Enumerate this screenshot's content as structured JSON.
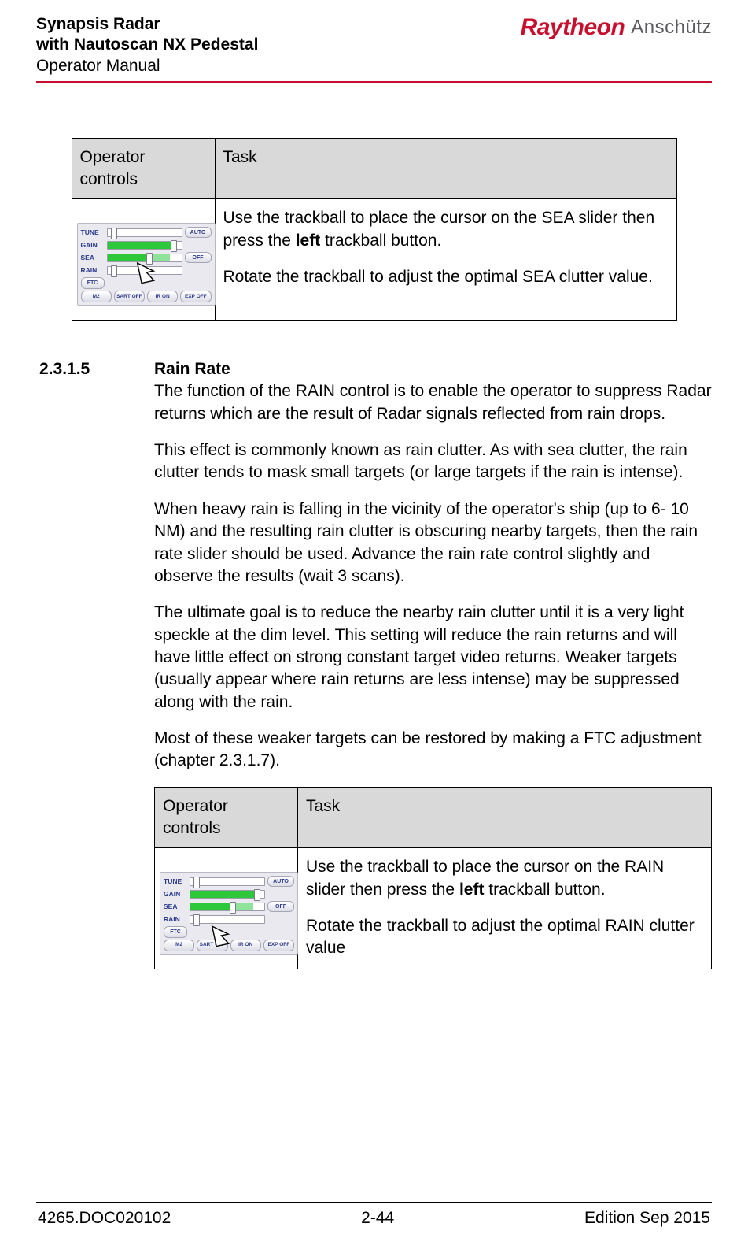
{
  "header": {
    "line1": "Synapsis Radar",
    "line2": "with Nautoscan NX Pedestal",
    "line3": "Operator Manual",
    "brand_primary": "Raytheon",
    "brand_secondary": "Anschütz"
  },
  "panel": {
    "rows": {
      "tune": {
        "label": "TUNE",
        "button": "AUTO"
      },
      "gain": {
        "label": "GAIN"
      },
      "sea": {
        "label": "SEA",
        "button": "OFF"
      },
      "rain": {
        "label": "RAIN"
      },
      "ftc": {
        "label": "FTC"
      }
    },
    "bottom_buttons": {
      "b1": "M2",
      "b2": "SART OFF",
      "b3": "IR ON",
      "b4": "EXP OFF"
    }
  },
  "tables": {
    "header_col1": "Operator controls",
    "header_col2": "Task",
    "sea": {
      "task_line1_pre": "Use the trackball to place the cursor on the SEA slider then press the ",
      "task_line1_bold": "left",
      "task_line1_post": " trackball button.",
      "task_line2": "Rotate the trackball to adjust the optimal SEA clutter value."
    },
    "rain": {
      "task_line1_pre": "Use the trackball to place the cursor on the RAIN slider then press the ",
      "task_line1_bold": "left",
      "task_line1_post": " trackball button.",
      "task_line2": "Rotate the trackball to adjust the optimal RAIN clutter value"
    }
  },
  "section": {
    "number": "2.3.1.5",
    "title": "Rain Rate",
    "p1": "The function of the RAIN control is to enable the operator to suppress Radar returns which are the result of Radar signals reflected from rain drops.",
    "p2": "This effect is commonly known as rain clutter. As with sea clutter, the rain clutter tends to mask small targets (or large targets if the rain is intense).",
    "p3": "When heavy rain is falling in the vicinity of the operator's ship (up to 6- 10 NM) and the resulting rain clutter is obscuring nearby targets, then the rain rate slider should be used. Advance the rain rate control slightly and observe the results (wait 3 scans).",
    "p4": "The ultimate goal is to reduce the nearby rain clutter until it is a very light speckle at the dim level. This setting will reduce the rain returns and will have little effect on strong constant target video returns. Weaker targets (usually appear where rain returns are less intense) may be suppressed along with the rain.",
    "p5": "Most of these weaker targets can be restored by making a FTC adjustment (chapter 2.3.1.7)."
  },
  "footer": {
    "left": "4265.DOC020102",
    "center": "2-44",
    "right": "Edition Sep 2015"
  }
}
